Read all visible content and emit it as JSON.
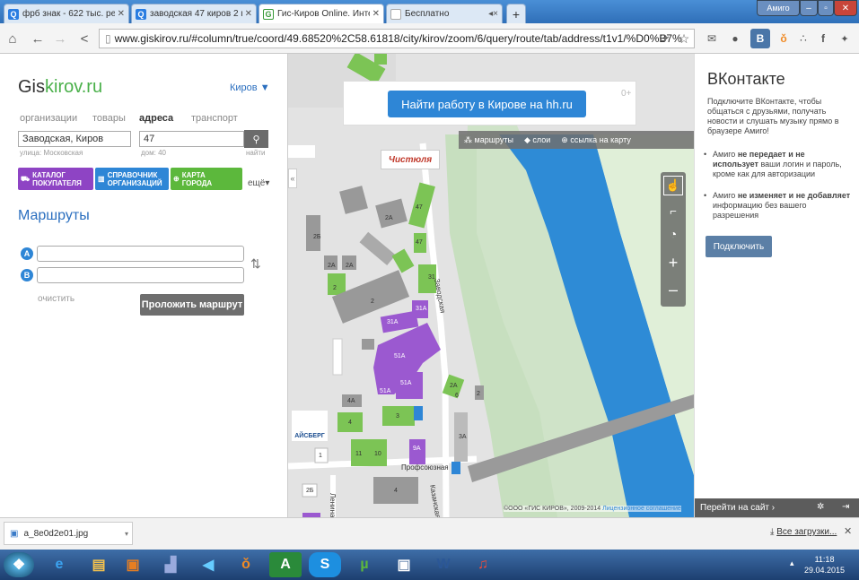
{
  "tabs": [
    {
      "title": "фрб знак - 622 тыс. результ",
      "fav": "Q"
    },
    {
      "title": "заводская 47 киров 2 гис -",
      "fav": "Q"
    },
    {
      "title": "Гис-Киров Online. Интерак",
      "fav": "G"
    },
    {
      "title": "Бесплатно",
      "fav": ""
    }
  ],
  "window": {
    "amigo_label": "Амиго"
  },
  "url": "www.giskirov.ru/#column/true/coord/49.68520%2C58.61818/city/kirov/zoom/6/query/route/tab/address/t1v1/%D0%B7%",
  "logo": {
    "part1": "Gis",
    "part2": "kirov.ru"
  },
  "city": "Киров",
  "search_tabs": [
    "организации",
    "товары",
    "адреса",
    "транспорт"
  ],
  "street_value": "Заводская, Киров",
  "house_value": "47",
  "street_hint": "улица: Московская",
  "house_hint": "дом: 40",
  "find_label": "найти",
  "cats": [
    {
      "l1": "КАТАЛОГ",
      "l2": "ПОКУПАТЕЛЯ"
    },
    {
      "l1": "СПРАВОЧНИК",
      "l2": "ОРГАНИЗАЦИЙ"
    },
    {
      "l1": "КАРТА",
      "l2": "ГОРОДА"
    }
  ],
  "more_label": "ещё▾",
  "routes_title": "Маршруты",
  "point_a": "A",
  "point_b": "B",
  "clear_label": "очистить",
  "route_button": "Проложить маршрут",
  "banner": {
    "text": "Найти работу в Кирове на hh.ru",
    "age": "0+"
  },
  "map_tools": {
    "routes": "маршруты",
    "layers": "слои",
    "link": "ссылка на карту"
  },
  "map_labels": {
    "street1": "Заводская",
    "street2": "Профсоюзная",
    "street3": "Ленина",
    "street4": "Казанская",
    "logo1": "Чистюля",
    "logo2": "АЙСБЕРГ",
    "copyright": "©ООО «ГИС КИРОВ», 2009-2014",
    "license": "Лицензионное соглашение"
  },
  "buildings": [
    "47",
    "2А",
    "47",
    "31",
    "2Б",
    "2А",
    "2А",
    "2",
    "2",
    "31А",
    "51А",
    "31А",
    "51А",
    "51А",
    "2А",
    "4А",
    "4",
    "3",
    "2",
    "1",
    "11",
    "10",
    "9А",
    "2Б",
    "4",
    "3А",
    "6"
  ],
  "vk": {
    "title": "ВКонтакте",
    "desc": "Подключите ВКонтакте, чтобы общаться с друзьями, получать новости и слушать музыку прямо в браузере Амиго!",
    "b1_pre": "Амиго ",
    "b1_bold": "не передает и не использует",
    "b1_post": " ваши логин и пароль, кроме как для авторизации",
    "b2_pre": "Амиго ",
    "b2_bold": "не изменяет и не добавляет",
    "b2_post": " информацию без вашего разрешения",
    "connect": "Подключить",
    "goto": "Перейти на сайт ›"
  },
  "download": {
    "file": "a_8e0d2e01.jpg",
    "all": "Все загрузки..."
  },
  "clock": {
    "time": "11:18",
    "date": "29.04.2015"
  },
  "colors": {
    "purple": "#8e44c4",
    "green": "#7cc455",
    "water": "#2e8bd6",
    "accent": "#2b6fbf"
  }
}
